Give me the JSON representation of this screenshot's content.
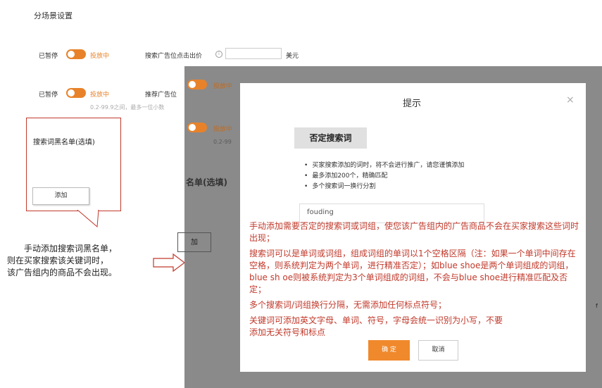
{
  "section": {
    "title": "分场景设置"
  },
  "rows": [
    {
      "status_label": "已暂停",
      "toggle_text": "投放中",
      "field_label": "搜索广告位点击出价",
      "unit": "美元"
    },
    {
      "status_label": "已暂停",
      "toggle_text": "投放中",
      "field_label": "推荐广告位",
      "hint": "0.2-99.9之间，最多一位小数"
    }
  ],
  "background_dimmed": {
    "toggles": [
      "投放中",
      "投放中"
    ],
    "hint": "0.2-99",
    "blacklist_label": "名单(选填)",
    "add_label": "加",
    "right_edge_char": "f"
  },
  "callout": {
    "title": "搜索词黑名单(选填)",
    "add_button": "添加"
  },
  "annotation": {
    "lines": [
      "手动添加搜索词黑名单，",
      "则在买家搜索该关键词时，",
      "该广告组内的商品不会出现。"
    ]
  },
  "modal": {
    "title": "提示",
    "close": "×",
    "neg_button": "否定搜索词",
    "rules": [
      "买家搜索添加的词时，将不会进行推广，请您谨慎添加",
      "最多添加200个，精确匹配",
      "多个搜索词一换行分割"
    ],
    "input_value": "fouding",
    "confirm": "确 定",
    "cancel": "取消"
  },
  "explanation": {
    "paragraphs": [
      "手动添加需要否定的搜索词或词组，使您该广告组内的广告商品不会在买家搜索这些词时出现；",
      "搜索词可以是单词或词组，组成词组的单词以1个空格区隔（注：如果一个单词中间存在空格，则系统判定为两个单词，进行精准否定）；如blue shoe是两个单词组成的词组，blue sh oe则被系统判定为3个单词组成的词组，不会与blue shoe进行精准匹配及否定；",
      "多个搜索词/词组换行分隔，无需添加任何标点符号；",
      "关键词可添加英文字母、单词、符号，字母会统一识别为小写，不要添加无关符号和标点"
    ]
  },
  "colors": {
    "accent": "#e8822a",
    "annotation_red": "#c0392b",
    "overlay": "#8a8a8a"
  }
}
